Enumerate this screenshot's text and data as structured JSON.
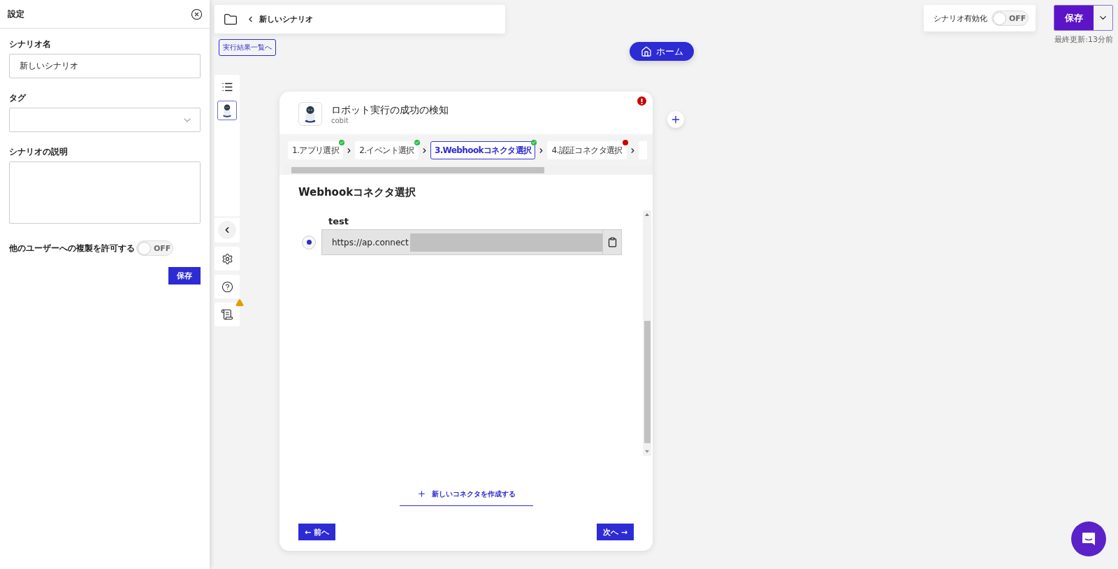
{
  "settings_panel": {
    "title": "設定",
    "fields": [
      {
        "kind": "text",
        "label": "シナリオ名",
        "value": "新しいシナリオ"
      },
      {
        "kind": "select",
        "label": "タグ"
      },
      {
        "kind": "textarea",
        "label": "シナリオの説明"
      }
    ],
    "copy_toggle": {
      "label": "他のユーザーへの複製を許可する",
      "on": false,
      "state_text": "OFF"
    },
    "save_button": "保存"
  },
  "header": {
    "back_title": "新しいシナリオ",
    "results_link": "実行結果一覧へ"
  },
  "home_button": "ホーム",
  "activation": {
    "label": "シナリオ有効化",
    "on": false,
    "state_text": "OFF"
  },
  "save_button": "保存",
  "last_updated": "最終更新:13分前",
  "node": {
    "title": "ロボット実行の成功の検知",
    "app": "cobit",
    "has_error": true,
    "steps": [
      {
        "label": "1.アプリ選択",
        "valid": true,
        "selected": false
      },
      {
        "label": "2.イベント選択",
        "valid": true,
        "selected": false
      },
      {
        "label": "3.Webhookコネクタ選択",
        "valid": true,
        "selected": true
      },
      {
        "label": "4.認証コネクタ選択",
        "valid": false,
        "selected": false
      }
    ],
    "section_title": "Webhookコネクタ選択",
    "connectors": [
      {
        "name": "test",
        "url": "https://ap.connect",
        "selected": true
      }
    ],
    "create_link": "新しいコネクタを作成する",
    "prev_button": "← 前へ",
    "next_button": "次へ →"
  }
}
